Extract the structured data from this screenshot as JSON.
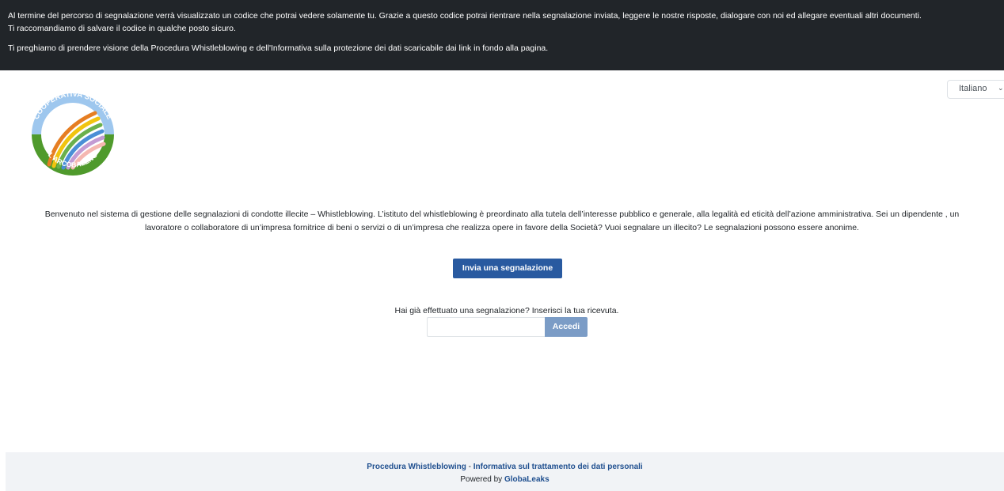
{
  "banner": {
    "line1": "Al termine del percorso di segnalazione verrà visualizzato un codice che potrai vedere solamente tu. Grazie a questo codice potrai rientrare nella segnalazione inviata, leggere le nostre risposte, dialogare con noi ed allegare eventuali altri documenti.",
    "line2": "Ti raccomandiamo di salvare il codice in qualche posto sicuro.",
    "line3": "Ti preghiamo di prendere visione della Procedura Whistleblowing e dell'Informativa sulla protezione dei dati scaricabile dai link in fondo alla pagina."
  },
  "language": {
    "selected": "Italiano",
    "icon": "chevron-down-icon"
  },
  "logo": {
    "top_text": "COOPERATIVA SOCIALE",
    "bottom_text": "L'ARCOBALENO",
    "colors": {
      "blue": "#4a8fd6",
      "green": "#4f9a2c",
      "rainbow": [
        "#e74c3c",
        "#f1c40f",
        "#2ecc71",
        "#3498db",
        "#9b59b6"
      ]
    }
  },
  "intro": {
    "line1": "Benvenuto nel sistema di gestione delle segnalazioni di condotte illecite – Whistleblowing. L’istituto del whistleblowing è preordinato alla tutela dell’interesse pubblico e generale, alla legalità ed eticità dell’azione amministrativa. Sei un dipendente , un",
    "line2": "lavoratore o collaboratore di un’impresa fornitrice di beni o servizi o di un’impresa che realizza opere in favore della Società? Vuoi segnalare un illecito? Le segnalazioni possono essere anonime."
  },
  "submit_button": "Invia una segnalazione",
  "receipt": {
    "label": "Hai già effettuato una segnalazione? Inserisci la tua ricevuta.",
    "input_value": "",
    "login_button": "Accedi"
  },
  "footer": {
    "link1": "Procedura Whistleblowing",
    "separator": " - ",
    "link2": "Informativa sul trattamento dei dati personali",
    "powered_prefix": "Powered by ",
    "powered_brand": "GlobaLeaks"
  },
  "colors": {
    "banner_bg": "#212529",
    "primary": "#295aa0",
    "primary_disabled": "#7b9cc6",
    "footer_bg": "#f1f3f6"
  }
}
